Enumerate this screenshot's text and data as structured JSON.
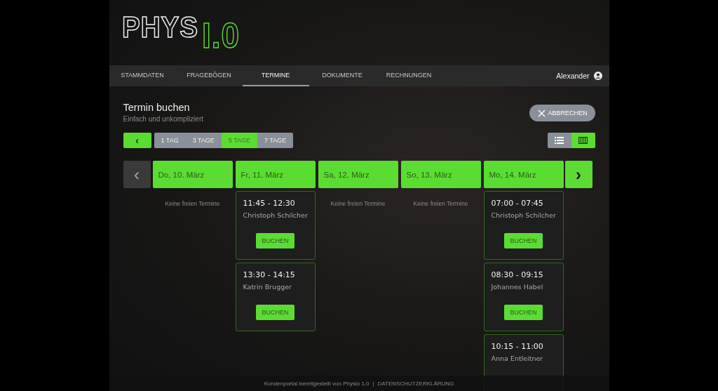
{
  "logo": {
    "word": "PHYS",
    "version": "I.0"
  },
  "nav": {
    "tabs": [
      {
        "label": "STAMMDATEN",
        "selected": false
      },
      {
        "label": "FRAGEBÖGEN",
        "selected": false
      },
      {
        "label": "TERMINE",
        "selected": true
      },
      {
        "label": "DOKUMENTE",
        "selected": false
      },
      {
        "label": "RECHNUNGEN",
        "selected": false
      }
    ],
    "user": "Alexander"
  },
  "heading": {
    "title": "Termin buchen",
    "subtitle": "Einfach und unkompliziert"
  },
  "cancel_button": "ABBRECHEN",
  "back_button": "‹",
  "ranges": [
    {
      "label": "1 TAG",
      "selected": false
    },
    {
      "label": "3 TAGE",
      "selected": false
    },
    {
      "label": "5 TAGE",
      "selected": true
    },
    {
      "label": "7 TAGE",
      "selected": false
    }
  ],
  "views": [
    {
      "kind": "list",
      "selected": false
    },
    {
      "kind": "columns",
      "selected": true
    }
  ],
  "prev_day": "‹",
  "next_day": "›",
  "days": [
    {
      "label": "Do, 10. März",
      "empty_text": "Keine freien Termine"
    },
    {
      "label": "Fr, 11. März",
      "slots": [
        {
          "time": "11:45 - 12:30",
          "therapist": "Christoph Schilcher",
          "button": "BUCHEN"
        },
        {
          "time": "13:30 - 14:15",
          "therapist": "Katrin Brugger",
          "button": "BUCHEN"
        }
      ]
    },
    {
      "label": "Sa, 12. März",
      "empty_text": "Keine freien Termine"
    },
    {
      "label": "So, 13. März",
      "empty_text": "Keine freien Termine"
    },
    {
      "label": "Mo, 14. März",
      "slots": [
        {
          "time": "07:00 - 07:45",
          "therapist": "Christoph Schilcher",
          "button": "BUCHEN"
        },
        {
          "time": "08:30 - 09:15",
          "therapist": "Johannes Habel",
          "button": "BUCHEN"
        },
        {
          "time": "10:15 - 11:00",
          "therapist": "Anna Entleitner"
        }
      ]
    }
  ],
  "footer": {
    "text": "Kundenportal bereitgestellt von Physio 1.0",
    "separator": "|",
    "link": "DATENSCHUTZERKLÄRUNG"
  }
}
